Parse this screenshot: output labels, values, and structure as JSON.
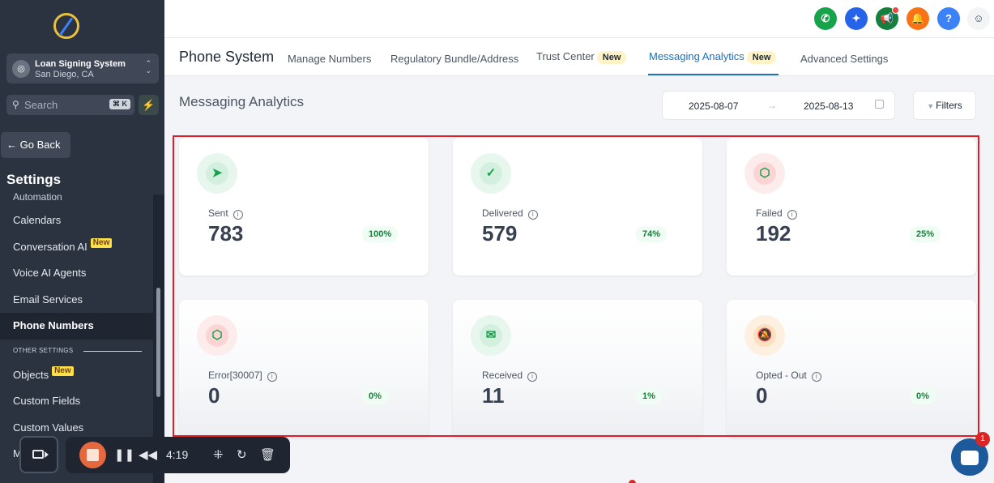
{
  "sidebar": {
    "location": {
      "name": "Loan Signing System",
      "city": "San Diego, CA"
    },
    "search": {
      "placeholder": "Search",
      "shortcut": "⌘ K"
    },
    "go_back": "← Go Back",
    "section_title": "Settings",
    "cut_item": "Automation",
    "items": [
      {
        "label": "Calendars",
        "badge": ""
      },
      {
        "label": "Conversation AI",
        "badge": "New"
      },
      {
        "label": "Voice AI Agents",
        "badge": ""
      },
      {
        "label": "Email Services",
        "badge": ""
      },
      {
        "label": "Phone Numbers",
        "badge": "",
        "active": true
      }
    ],
    "other_settings_label": "OTHER SETTINGS",
    "other_items": [
      {
        "label": "Objects",
        "badge": "New"
      },
      {
        "label": "Custom Fields",
        "badge": ""
      },
      {
        "label": "Custom Values",
        "badge": ""
      },
      {
        "label": "M",
        "badge": ""
      }
    ]
  },
  "topbar": {
    "buttons": [
      {
        "name": "phone-icon",
        "color": "#16a34a"
      },
      {
        "name": "sparkle-icon",
        "color": "#2563eb"
      },
      {
        "name": "megaphone-icon",
        "color": "#15803d"
      },
      {
        "name": "bell-icon",
        "color": "#f97316"
      },
      {
        "name": "help-icon",
        "color": "#3b82f6"
      }
    ],
    "help_glyph": "?"
  },
  "tabs": {
    "title": "Phone System",
    "items": [
      {
        "label": "Manage Numbers",
        "badge": ""
      },
      {
        "label": "Regulatory Bundle/Address",
        "badge": ""
      },
      {
        "label": "Trust Center",
        "badge": "New"
      },
      {
        "label": "Messaging Analytics",
        "badge": "New",
        "active": true
      },
      {
        "label": "Advanced Settings",
        "badge": ""
      }
    ]
  },
  "analytics": {
    "title": "Messaging Analytics",
    "start_date": "2025-08-07",
    "end_date": "2025-08-13",
    "filters_label": "Filters"
  },
  "cards": [
    {
      "label": "Sent",
      "value": "783",
      "percent": "100%",
      "icon": "send-icon",
      "tone": "green"
    },
    {
      "label": "Delivered",
      "value": "579",
      "percent": "74%",
      "icon": "check-circle-icon",
      "tone": "green"
    },
    {
      "label": "Failed",
      "value": "192",
      "percent": "25%",
      "icon": "alert-hexagon-icon",
      "tone": "red"
    },
    {
      "label": "Error[30007]",
      "value": "0",
      "percent": "0%",
      "icon": "alert-hexagon-icon",
      "tone": "red"
    },
    {
      "label": "Received",
      "value": "11",
      "percent": "1%",
      "icon": "envelope-open-icon",
      "tone": "green"
    },
    {
      "label": "Opted - Out",
      "value": "0",
      "percent": "0%",
      "icon": "bell-off-icon",
      "tone": "orange"
    }
  ],
  "recorder": {
    "time": "4:19"
  },
  "chat": {
    "badge": "1"
  }
}
